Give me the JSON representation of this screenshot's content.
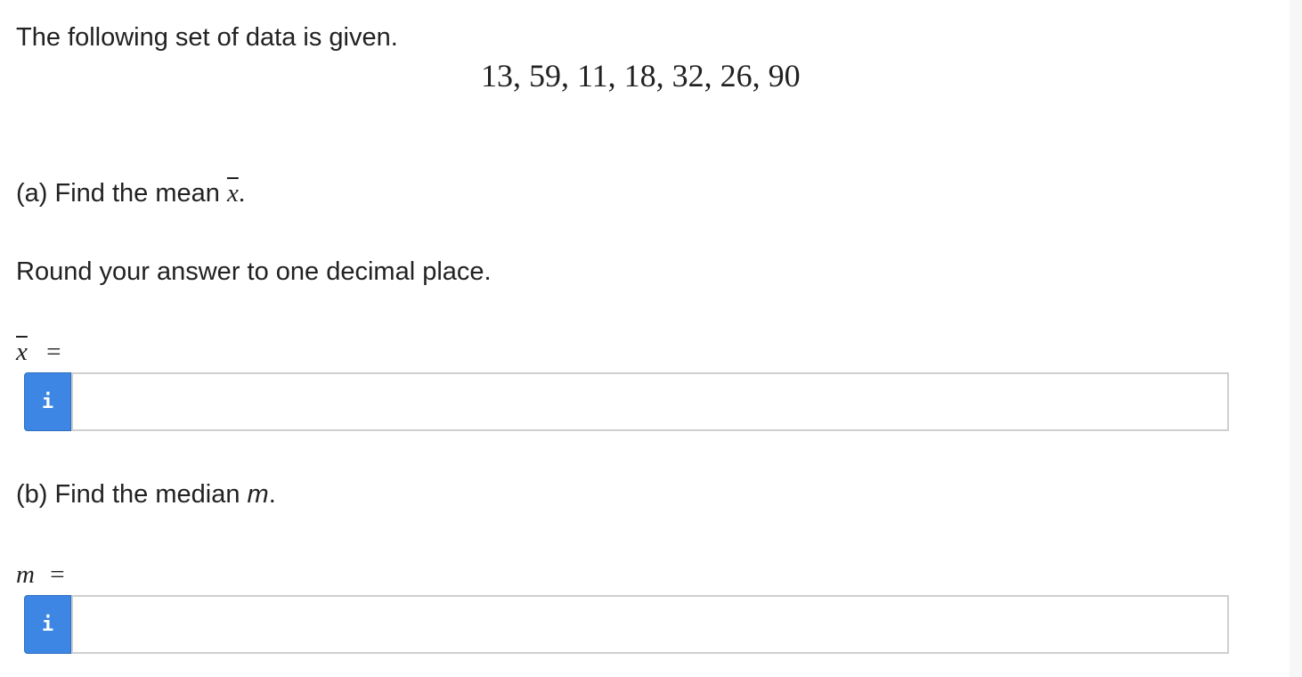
{
  "intro": {
    "text": "The following set of data is given.",
    "data_values": "13, 59, 11, 18, 32, 26, 90"
  },
  "part_a": {
    "prompt_prefix": "(a) Find the mean ",
    "prompt_symbol": "x",
    "prompt_suffix": ".",
    "instruction": "Round your answer to one decimal place.",
    "answer_symbol": "x",
    "answer_equals": "=",
    "info_icon": "i",
    "input_value": ""
  },
  "part_b": {
    "prompt_prefix": "(b) Find the median ",
    "prompt_symbol": "m",
    "prompt_suffix": ".",
    "answer_symbol": "m",
    "answer_equals": "=",
    "info_icon": "i",
    "input_value": ""
  },
  "colors": {
    "info_button": "#3d86e3",
    "text": "#222222",
    "input_border": "#cfcfcf"
  }
}
